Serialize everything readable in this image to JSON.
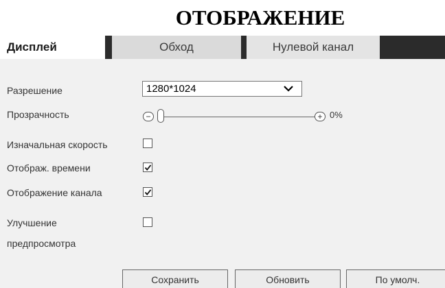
{
  "heading": "ОТОБРАЖЕНИЕ",
  "tabs": [
    {
      "label": "Дисплей",
      "active": true
    },
    {
      "label": "Обход",
      "active": false
    },
    {
      "label": "Нулевой канал",
      "active": false
    }
  ],
  "form": {
    "resolution": {
      "label": "Разрешение",
      "value": "1280*1024"
    },
    "transparency": {
      "label": "Прозрачность",
      "value": "0%",
      "level": 0
    },
    "initial_speed": {
      "label": "Изначальная скорость",
      "checked": false
    },
    "show_time": {
      "label": "Отображ. времени",
      "checked": true
    },
    "show_channel": {
      "label": "Отображение канала",
      "checked": true
    },
    "preview_enhance": {
      "label_line1": "Улучшение",
      "label_line2": "предпросмотра",
      "checked": false
    }
  },
  "buttons": {
    "save": "Сохранить",
    "refresh": "Обновить",
    "default": "По умолч."
  },
  "icons": {
    "minus": "−",
    "plus": "+"
  }
}
